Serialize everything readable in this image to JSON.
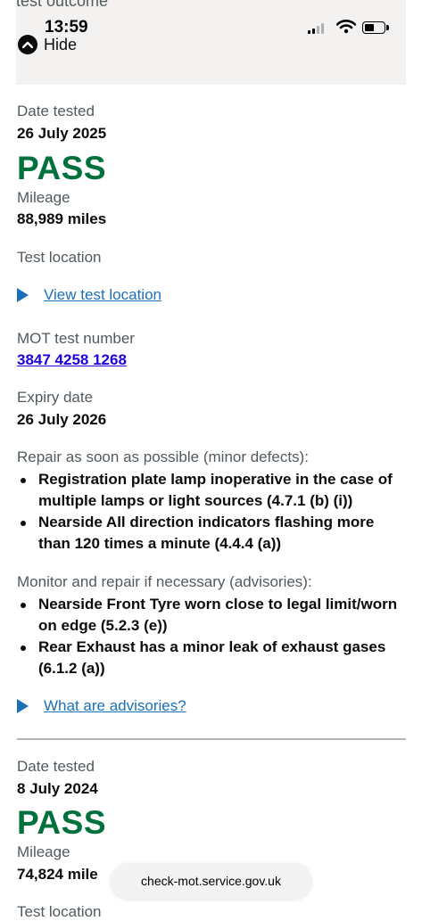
{
  "status": {
    "time": "13:59",
    "hide_label": "Hide",
    "cut_heading": "test outcome"
  },
  "test1": {
    "date_label": "Date tested",
    "date": "26 July 2025",
    "result": "PASS",
    "mileage_label": "Mileage",
    "mileage": "88,989 miles",
    "location_label": "Test location",
    "location_link": "View test location",
    "number_label": "MOT test number",
    "number": "3847 4258 1268",
    "expiry_label": "Expiry date",
    "expiry": "26 July 2026",
    "minor_label": "Repair as soon as possible (minor defects):",
    "minor_defects": [
      "Registration plate lamp inoperative in the case of multiple lamps or light sources (4.7.1 (b) (i))",
      "Nearside All direction indicators flashing more than 120 times a minute (4.4.4 (a))"
    ],
    "advisory_label": "Monitor and repair if necessary (advisories):",
    "advisories": [
      "Nearside Front Tyre worn close to legal limit/worn on edge (5.2.3 (e))",
      "Rear Exhaust has a minor leak of exhaust gases (6.1.2 (a))"
    ],
    "advisories_link": "What are advisories?"
  },
  "test2": {
    "date_label": "Date tested",
    "date": "8 July 2024",
    "result": "PASS",
    "mileage_label": "Mileage",
    "mileage": "74,824 mile",
    "location_label": "Test location"
  },
  "browser": {
    "url": "check-mot.service.gov.uk"
  },
  "colors": {
    "pass_green": "#00703c",
    "link_blue": "#1d70b8",
    "text": "#0b0c0c",
    "secondary_text": "#505a5f"
  }
}
